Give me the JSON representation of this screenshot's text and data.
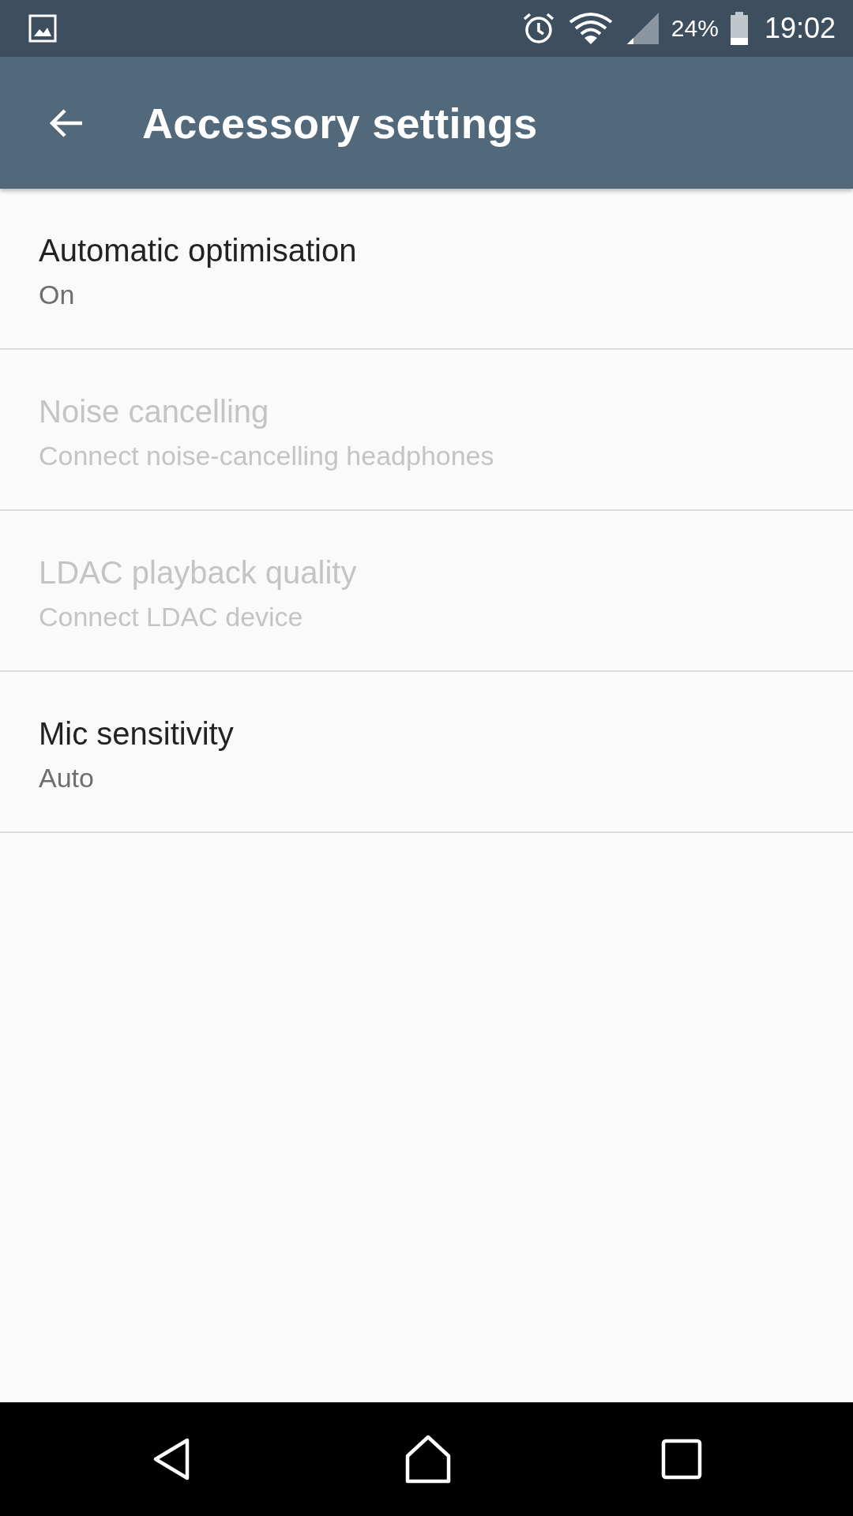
{
  "status_bar": {
    "battery_percent": "24%",
    "time": "19:02"
  },
  "app_bar": {
    "title": "Accessory settings"
  },
  "settings": [
    {
      "title": "Automatic optimisation",
      "summary": "On",
      "disabled": false
    },
    {
      "title": "Noise cancelling",
      "summary": "Connect noise-cancelling headphones",
      "disabled": true
    },
    {
      "title": "LDAC playback quality",
      "summary": "Connect LDAC device",
      "disabled": true
    },
    {
      "title": "Mic sensitivity",
      "summary": "Auto",
      "disabled": false
    }
  ]
}
